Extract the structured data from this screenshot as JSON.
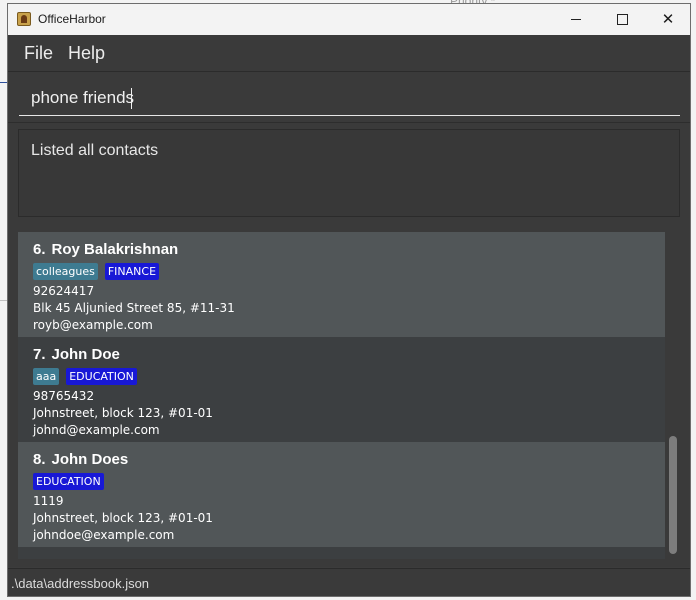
{
  "window": {
    "title": "OfficeHarbor"
  },
  "background": {
    "ghost_text": "Priority *"
  },
  "menu": {
    "file": "File",
    "help": "Help"
  },
  "command": {
    "value": "phone friends"
  },
  "result": {
    "text": "Listed all contacts"
  },
  "contacts": [
    {
      "index": "6.",
      "name": "Roy Balakrishnan",
      "tags": [
        "colleagues",
        "FINANCE"
      ],
      "phone": "92624417",
      "address": "Blk 45 Aljunied Street 85, #11-31",
      "email": "royb@example.com"
    },
    {
      "index": "7.",
      "name": "John Doe",
      "tags": [
        "aaa",
        "EDUCATION"
      ],
      "phone": "98765432",
      "address": "Johnstreet, block 123, #01-01",
      "email": "johnd@example.com"
    },
    {
      "index": "8.",
      "name": "John Does",
      "tags": [
        "EDUCATION"
      ],
      "phone": "1119",
      "address": "Johnstreet, block 123, #01-01",
      "email": "johndoe@example.com"
    }
  ],
  "status": {
    "path": ".\\data\\addressbook.json"
  },
  "colors": {
    "tag_general": "#3e7b91",
    "tag_department": "#1818d6",
    "card_light": "#515658",
    "card_dark": "#3c3f41"
  },
  "icons": {
    "app": "app-icon",
    "minimize": "minimize-icon",
    "maximize": "maximize-icon",
    "close": "close-icon"
  }
}
